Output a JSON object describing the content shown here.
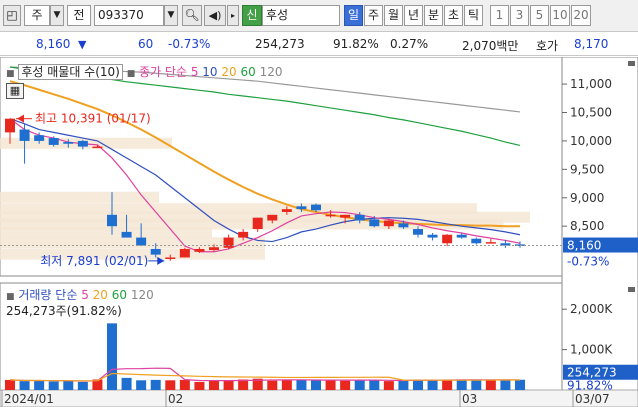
{
  "toolbar": {
    "type_label": "주",
    "prev_label": "전",
    "code": "093370",
    "name_badge": "신",
    "stock_name": "후성",
    "periods": [
      "일",
      "주",
      "월",
      "년",
      "분",
      "초",
      "틱"
    ],
    "active_period": "일",
    "intervals": [
      "1",
      "3",
      "5",
      "10",
      "20"
    ]
  },
  "info": {
    "price": "8,160",
    "change_arrow": "▼",
    "change": "60",
    "change_pct": "-0.73%",
    "volume": "254,273",
    "vol_ratio": "91.82%",
    "turnover_pct": "0.27%",
    "amount": "2,070백만",
    "ask_label": "호가",
    "ask_price": "8,170"
  },
  "price_panel": {
    "title": "후성 매물대 수(10)",
    "ma_label": "종가 단순",
    "ma_periods": [
      "5",
      "10",
      "20",
      "60",
      "120"
    ],
    "ma_colors": [
      "#e040a0",
      "#3050c0",
      "#f0a020",
      "#20a040",
      "#888888"
    ],
    "high_label": "최고 10,391 (01/17)",
    "low_label": "최저 7,891 (02/01)",
    "y_ticks": [
      "11,000",
      "10,500",
      "10,000",
      "9,500",
      "9,000",
      "8,500"
    ],
    "current_price": "8,160",
    "current_pct": "-0.73%"
  },
  "volume_panel": {
    "title": "거래량 단순",
    "ma_periods": [
      "5",
      "20",
      "60",
      "120"
    ],
    "ma_colors": [
      "#e040a0",
      "#f0a020",
      "#20a040",
      "#888888"
    ],
    "summary": "254,273주(91.82%)",
    "y_ticks": [
      "2,000K",
      "1,000K"
    ],
    "current_volume": "254,273",
    "current_pct": "91.82%"
  },
  "x_labels": [
    "2024/01",
    "02",
    "03",
    "03/07"
  ],
  "chart_data": {
    "type": "candlestick",
    "ylim": [
      7800,
      11300
    ],
    "candles": [
      {
        "o": 10150,
        "h": 10391,
        "l": 9950,
        "c": 10391
      },
      {
        "o": 10200,
        "h": 10300,
        "l": 9600,
        "c": 10000
      },
      {
        "o": 10100,
        "h": 10150,
        "l": 9950,
        "c": 10000
      },
      {
        "o": 10050,
        "h": 10080,
        "l": 9900,
        "c": 9930
      },
      {
        "o": 9980,
        "h": 10030,
        "l": 9880,
        "c": 9950
      },
      {
        "o": 10000,
        "h": 10020,
        "l": 9850,
        "c": 9900
      },
      {
        "o": 9900,
        "h": 9920,
        "l": 9880,
        "c": 9900
      },
      {
        "o": 8700,
        "h": 9100,
        "l": 8350,
        "c": 8500
      },
      {
        "o": 8400,
        "h": 8700,
        "l": 8300,
        "c": 8300
      },
      {
        "o": 8300,
        "h": 8550,
        "l": 8150,
        "c": 8160
      },
      {
        "o": 8100,
        "h": 8200,
        "l": 7950,
        "c": 8000
      },
      {
        "o": 7950,
        "h": 8000,
        "l": 7891,
        "c": 7950
      },
      {
        "o": 7950,
        "h": 8120,
        "l": 7950,
        "c": 8100
      },
      {
        "o": 8050,
        "h": 8130,
        "l": 8030,
        "c": 8100
      },
      {
        "o": 8080,
        "h": 8180,
        "l": 8050,
        "c": 8130
      },
      {
        "o": 8120,
        "h": 8350,
        "l": 8100,
        "c": 8300
      },
      {
        "o": 8300,
        "h": 8450,
        "l": 8250,
        "c": 8400
      },
      {
        "o": 8450,
        "h": 8650,
        "l": 8400,
        "c": 8650
      },
      {
        "o": 8600,
        "h": 8700,
        "l": 8550,
        "c": 8700
      },
      {
        "o": 8750,
        "h": 8850,
        "l": 8700,
        "c": 8800
      },
      {
        "o": 8850,
        "h": 8900,
        "l": 8750,
        "c": 8800
      },
      {
        "o": 8880,
        "h": 8900,
        "l": 8750,
        "c": 8780
      },
      {
        "o": 8700,
        "h": 8780,
        "l": 8650,
        "c": 8700
      },
      {
        "o": 8650,
        "h": 8700,
        "l": 8550,
        "c": 8700
      },
      {
        "o": 8700,
        "h": 8750,
        "l": 8550,
        "c": 8600
      },
      {
        "o": 8620,
        "h": 8680,
        "l": 8480,
        "c": 8500
      },
      {
        "o": 8500,
        "h": 8620,
        "l": 8450,
        "c": 8600
      },
      {
        "o": 8550,
        "h": 8600,
        "l": 8450,
        "c": 8480
      },
      {
        "o": 8450,
        "h": 8500,
        "l": 8300,
        "c": 8350
      },
      {
        "o": 8350,
        "h": 8380,
        "l": 8250,
        "c": 8300
      },
      {
        "o": 8200,
        "h": 8360,
        "l": 8150,
        "c": 8350
      },
      {
        "o": 8350,
        "h": 8380,
        "l": 8280,
        "c": 8300
      },
      {
        "o": 8280,
        "h": 8300,
        "l": 8180,
        "c": 8200
      },
      {
        "o": 8220,
        "h": 8280,
        "l": 8200,
        "c": 8220
      },
      {
        "o": 8200,
        "h": 8260,
        "l": 8120,
        "c": 8160
      },
      {
        "o": 8180,
        "h": 8230,
        "l": 8120,
        "c": 8160
      }
    ],
    "volumes": [
      250,
      220,
      240,
      210,
      230,
      200,
      260,
      1650,
      300,
      240,
      250,
      240,
      250,
      200,
      230,
      240,
      260,
      280,
      230,
      240,
      250,
      240,
      260,
      230,
      240,
      250,
      220,
      240,
      260,
      250,
      260,
      240,
      250,
      260,
      240,
      254
    ],
    "vol_ylim": [
      0,
      2500
    ],
    "ma5": [
      10391,
      10200,
      10100,
      10050,
      9980,
      9950,
      9930,
      9700,
      9400,
      9050,
      8750,
      8450,
      8150,
      8050,
      8050,
      8100,
      8200,
      8300,
      8420,
      8560,
      8680,
      8720,
      8750,
      8740,
      8700,
      8650,
      8620,
      8580,
      8530,
      8470,
      8420,
      8380,
      8330,
      8290,
      8250,
      8200
    ],
    "ma10": [
      10391,
      10300,
      10200,
      10150,
      10100,
      10050,
      10000,
      9850,
      9700,
      9550,
      9400,
      9200,
      9000,
      8800,
      8600,
      8450,
      8320,
      8250,
      8230,
      8300,
      8400,
      8450,
      8520,
      8580,
      8620,
      8640,
      8650,
      8640,
      8620,
      8580,
      8540,
      8500,
      8470,
      8440,
      8400,
      8350
    ],
    "ma20": [
      11050,
      10980,
      10900,
      10820,
      10740,
      10650,
      10560,
      10450,
      10330,
      10200,
      10060,
      9910,
      9760,
      9610,
      9460,
      9320,
      9190,
      9070,
      8970,
      8880,
      8800,
      8750,
      8700,
      8660,
      8620,
      8590,
      8570,
      8550,
      8540,
      8530,
      8520,
      8520,
      8510,
      8510,
      8500,
      8500
    ],
    "ma60": [
      11300,
      11260,
      11230,
      11200,
      11170,
      11140,
      11110,
      11080,
      11040,
      11010,
      10980,
      10950,
      10920,
      10890,
      10860,
      10820,
      10790,
      10760,
      10730,
      10700,
      10660,
      10620,
      10580,
      10540,
      10500,
      10460,
      10410,
      10370,
      10320,
      10270,
      10220,
      10170,
      10110,
      10050,
      9980,
      9920
    ],
    "ma120": [
      11300,
      11290,
      11280,
      11270,
      11260,
      11250,
      11240,
      11230,
      11220,
      11210,
      11190,
      11170,
      11150,
      11130,
      11110,
      11090,
      11070,
      11050,
      11020,
      10990,
      10960,
      10930,
      10900,
      10870,
      10840,
      10810,
      10780,
      10750,
      10720,
      10690,
      10660,
      10630,
      10600,
      10570,
      10540,
      10510
    ],
    "profile_bands": [
      {
        "price": 9950,
        "size": 0.8
      },
      {
        "price": 9000,
        "size": 0.3
      },
      {
        "price": 8800,
        "size": 0.9
      },
      {
        "price": 8650,
        "size": 1.0
      },
      {
        "price": 8530,
        "size": 0.95
      },
      {
        "price": 8380,
        "size": 0.4
      },
      {
        "price": 8200,
        "size": 0.5
      },
      {
        "price": 8000,
        "size": 0.5
      }
    ]
  }
}
